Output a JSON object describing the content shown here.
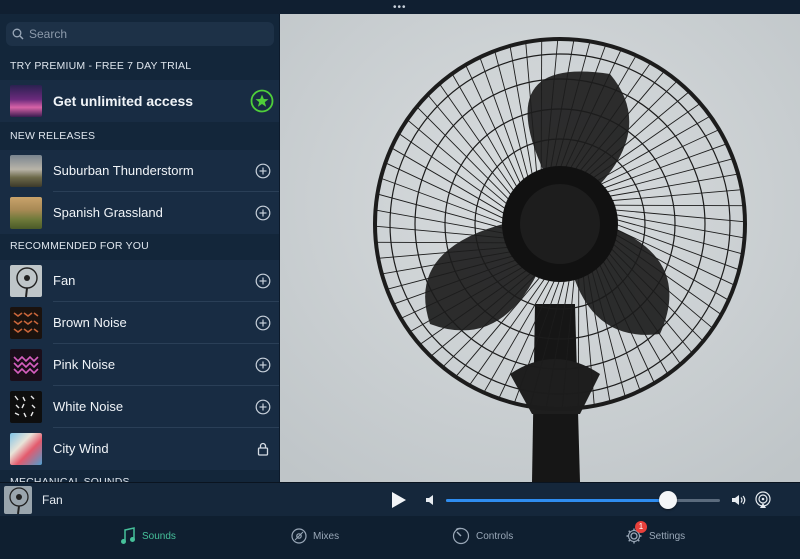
{
  "window": {
    "handle_dots": "•••"
  },
  "search": {
    "placeholder": "Search"
  },
  "premium": {
    "section_title": "TRY PREMIUM - FREE 7 DAY TRIAL",
    "label": "Get unlimited access"
  },
  "new_releases": {
    "section_title": "NEW RELEASES",
    "items": [
      {
        "label": "Suburban Thunderstorm",
        "action": "add"
      },
      {
        "label": "Spanish Grassland",
        "action": "add"
      }
    ]
  },
  "recommended": {
    "section_title": "RECOMMENDED FOR YOU",
    "items": [
      {
        "label": "Fan",
        "action": "add"
      },
      {
        "label": "Brown Noise",
        "action": "add"
      },
      {
        "label": "Pink Noise",
        "action": "add"
      },
      {
        "label": "White Noise",
        "action": "add"
      },
      {
        "label": "City Wind",
        "action": "locked"
      }
    ]
  },
  "mechanical": {
    "section_title": "MECHANICAL SOUNDS"
  },
  "player": {
    "now_playing": "Fan",
    "volume": 0.81
  },
  "tabs": [
    {
      "label": "Sounds",
      "active": true
    },
    {
      "label": "Mixes",
      "active": false
    },
    {
      "label": "Controls",
      "active": false
    },
    {
      "label": "Settings",
      "active": false,
      "badge": "1"
    }
  ],
  "colors": {
    "accent": "#46c19a",
    "slider": "#2f8df0",
    "badge": "#e8403b",
    "premium_star": "#4fcf3a"
  }
}
